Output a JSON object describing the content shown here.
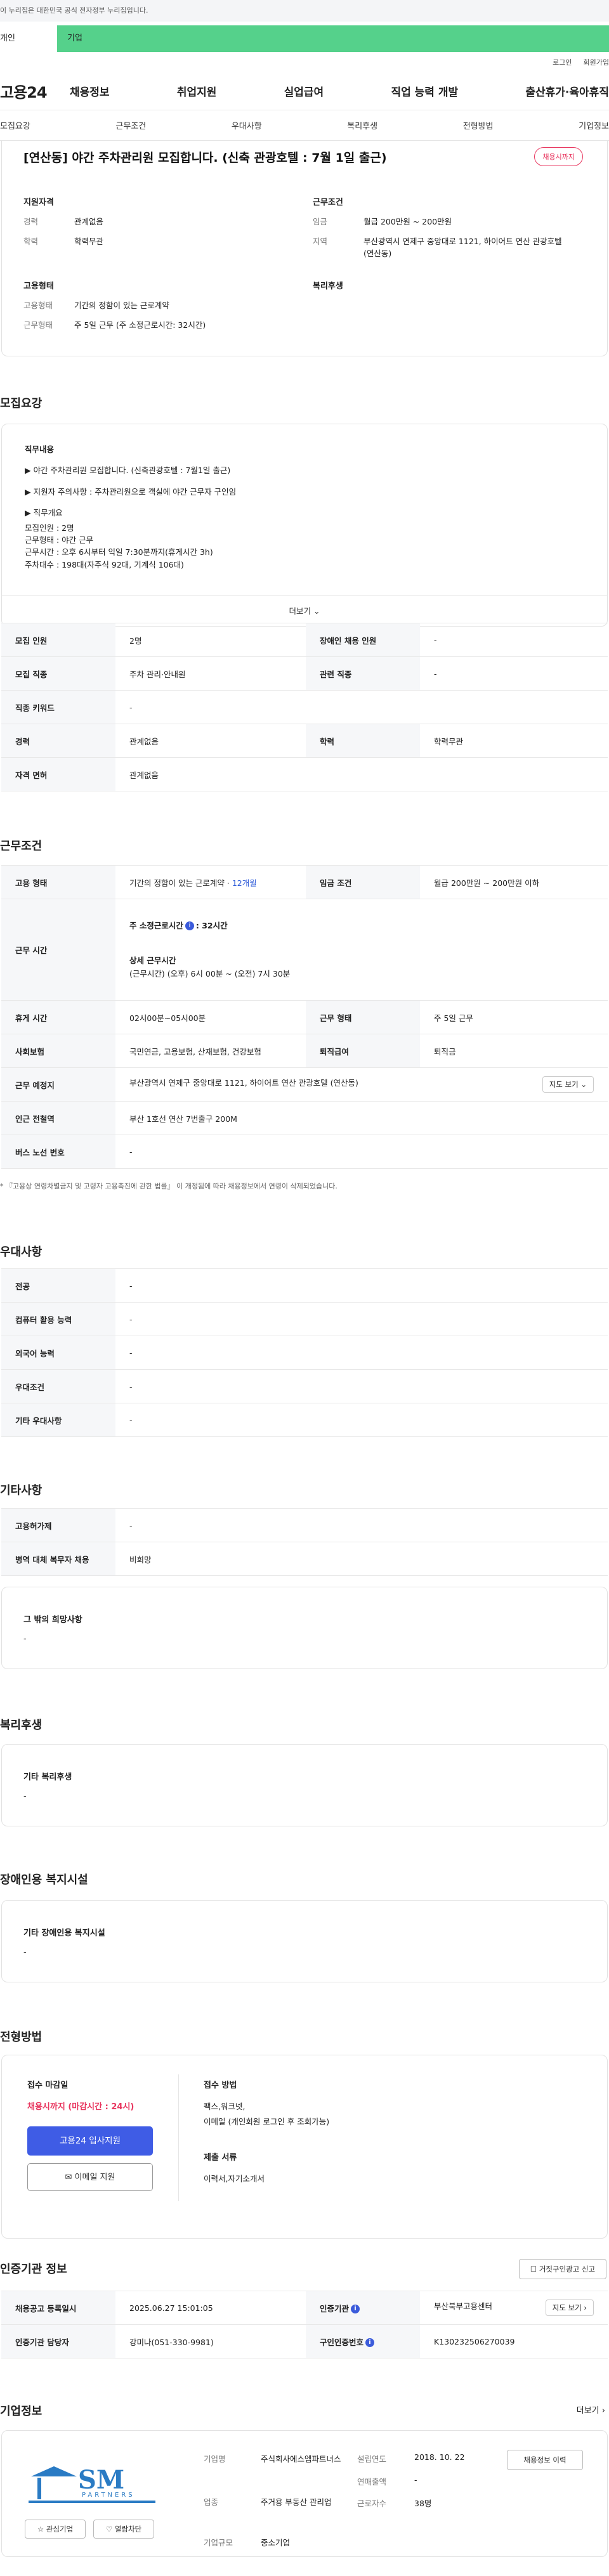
{
  "header": {
    "gov_notice": "이 누리집은 대한민국 공식 전자정부 누리집입니다.",
    "tab_person": "개인",
    "tab_company": "기업",
    "login": "로그인",
    "signup": "회원가입",
    "logo": "고용24",
    "menu": [
      "채용정보",
      "취업지원",
      "실업급여",
      "직업 능력 개발",
      "출산휴가·육아휴직"
    ]
  },
  "subnav": [
    "모집요강",
    "근무조건",
    "우대사항",
    "복리후생",
    "전형방법",
    "기업정보"
  ],
  "summary": {
    "title": "[연산동] 야간 주차관리원 모집합니다. (신축 관광호텔 : 7월 1일 출근)",
    "badge": "채용시까지",
    "qual_head": "지원자격",
    "qual": [
      {
        "k": "경력",
        "v": "관계없음"
      },
      {
        "k": "학력",
        "v": "학력무관"
      }
    ],
    "cond_head": "근무조건",
    "cond": [
      {
        "k": "임금",
        "v": "월급 200만원 ~ 200만원"
      },
      {
        "k": "지역",
        "v": "부산광역시 연제구 중앙대로 1121, 하이어트 연산 관광호텔 (연산동)"
      }
    ],
    "emp_head": "고용형태",
    "emp": [
      {
        "k": "고용형태",
        "v": "기간의 정함이 있는 근로계약"
      },
      {
        "k": "근무형태",
        "v": "주 5일 근무 (주 소정근로시간: 32시간)"
      }
    ],
    "welfare_head": "복리후생"
  },
  "recruit": {
    "section_title": "모집요강",
    "detail_head": "직무내용",
    "detail_lines": [
      "▶ 야간 주차관리원 모집합니다. (신축관광호텔 : 7월1일 출근)",
      "▶ 지원자 주의사항 :  주차관리원으로 객실에 야간 근무자 구인임",
      "▶ 직무개요",
      "모집인원 : 2명",
      "근무형태 : 야간 근무",
      "근무시간 : 오후 6시부터 익일 7:30분까지(휴게시간 3h)",
      "주차대수 : 198대(자주식 92대, 기계식 106대)"
    ],
    "more": "더보기",
    "rows": [
      {
        "h1": "모집 인원",
        "v1": "2명",
        "h2": "장애인 채용 인원",
        "v2": "-"
      },
      {
        "h1": "모집 직종",
        "v1": "주차 관리·안내원",
        "h2": "관련 직종",
        "v2": "-"
      },
      {
        "h1": "직종 키워드",
        "v1": "-"
      },
      {
        "h1": "경력",
        "v1": "관계없음",
        "h2": "학력",
        "v2": "학력무관"
      },
      {
        "h1": "자격 면허",
        "v1": "관계없음"
      }
    ]
  },
  "conditions": {
    "section_title": "근무조건",
    "emp_type_h": "고용 형태",
    "emp_type_v": "기간의 정함이 있는 근로계약 · ",
    "emp_type_link": "12개월",
    "wage_h": "임금 조건",
    "wage_v": "월급 200만원 ~ 200만원 이하",
    "hours_h": "근무 시간",
    "hours_week_label": "주 소정근로시간",
    "hours_week_value": ": 32시간",
    "hours_detail_label": "상세 근무시간",
    "hours_detail_value": "(근무시간) (오후) 6시 00분 ~ (오전) 7시 30분",
    "break_h": "휴게 시간",
    "break_v": "02시00분~05시00분",
    "work_form_h": "근무 형태",
    "work_form_v": "주 5일 근무",
    "insurance_h": "사회보험",
    "insurance_v": "국민연금, 고용보험, 산재보험, 건강보험",
    "severance_h": "퇴직급여",
    "severance_v": "퇴직금",
    "place_h": "근무 예정지",
    "place_v": "부산광역시 연제구 중앙대로 1121, 하이어트 연산 관광호텔 (연산동)",
    "map_btn": "지도 보기",
    "subway_h": "인근 전철역",
    "subway_v": "부산 1호선 연산 7번출구 200M",
    "bus_h": "버스 노선 번호",
    "bus_v": "-",
    "note": "* 『고용상 연령차별금지 및 고령자 고용촉진에 관한 법률』 이 개정됨에 따라 채용정보에서 연령이 삭제되었습니다."
  },
  "preference": {
    "section_title": "우대사항",
    "rows": [
      {
        "h": "전공",
        "v": "-"
      },
      {
        "h": "컴퓨터 활용 능력",
        "v": "-"
      },
      {
        "h": "외국어 능력",
        "v": "-"
      },
      {
        "h": "우대조건",
        "v": "-"
      },
      {
        "h": "기타 우대사항",
        "v": "-"
      }
    ]
  },
  "etc": {
    "section_title": "기타사항",
    "rows": [
      {
        "h": "고용허가제",
        "v": "-"
      },
      {
        "h": "병역 대체 복무자 채용",
        "v": "비희망"
      }
    ],
    "hope_title": "그 밖의 희망사항",
    "hope_value": "-"
  },
  "welfare": {
    "section_title": "복리후생",
    "box_title": "기타 복리후생",
    "box_value": "-"
  },
  "disability": {
    "section_title": "장애인용 복지시설",
    "box_title": "기타 장애인용 복지시설",
    "box_value": "-"
  },
  "selection": {
    "section_title": "전형방법",
    "deadline_label": "접수 마감일",
    "deadline_value": "채용시까지 (마감시간 : 24시)",
    "apply_btn": "고용24 입사지원",
    "email_btn": "이메일 지원",
    "method_label": "접수 방법",
    "method_value1": "팩스,워크넷,",
    "method_value2": "이메일 (개인회원 로그인 후 조회가능)",
    "docs_label": "제출 서류",
    "docs_value": "이력서,자기소개서"
  },
  "agency": {
    "section_title": "인증기관 정보",
    "report_btn": "거짓구인광고 신고",
    "reg_date_h": "채용공고 등록일시",
    "reg_date_v": "2025.06.27 15:01:05",
    "agency_h": "인증기관",
    "agency_v": "부산북부고용센터",
    "map_btn": "지도 보기",
    "manager_h": "인증기관 담당자",
    "manager_v": "강미나(051-330-9981)",
    "cert_h": "구인인증번호",
    "cert_v": "K130232506270039"
  },
  "company": {
    "section_title": "기업정보",
    "more": "더보기",
    "logo_text": "SM",
    "logo_sub": "PARTNERS",
    "fav_btn": "관심기업",
    "block_btn": "열람차단",
    "name_h": "기업명",
    "name_v": "주식회사에스엠파트너스",
    "industry_h": "업종",
    "industry_v": "주거용 부동산 관리업",
    "size_h": "기업규모",
    "size_v": "중소기업",
    "founded_h": "설립연도",
    "founded_v": "2018. 10. 22",
    "sales_h": "연매출액",
    "sales_v": "-",
    "employees_h": "근로자수",
    "employees_v": "38명",
    "recruit_btn": "채용정보 이력"
  },
  "colors": {
    "brand_green": "#55d18b",
    "primary_blue": "#3f5ce5",
    "badge_red": "#e8355e"
  }
}
